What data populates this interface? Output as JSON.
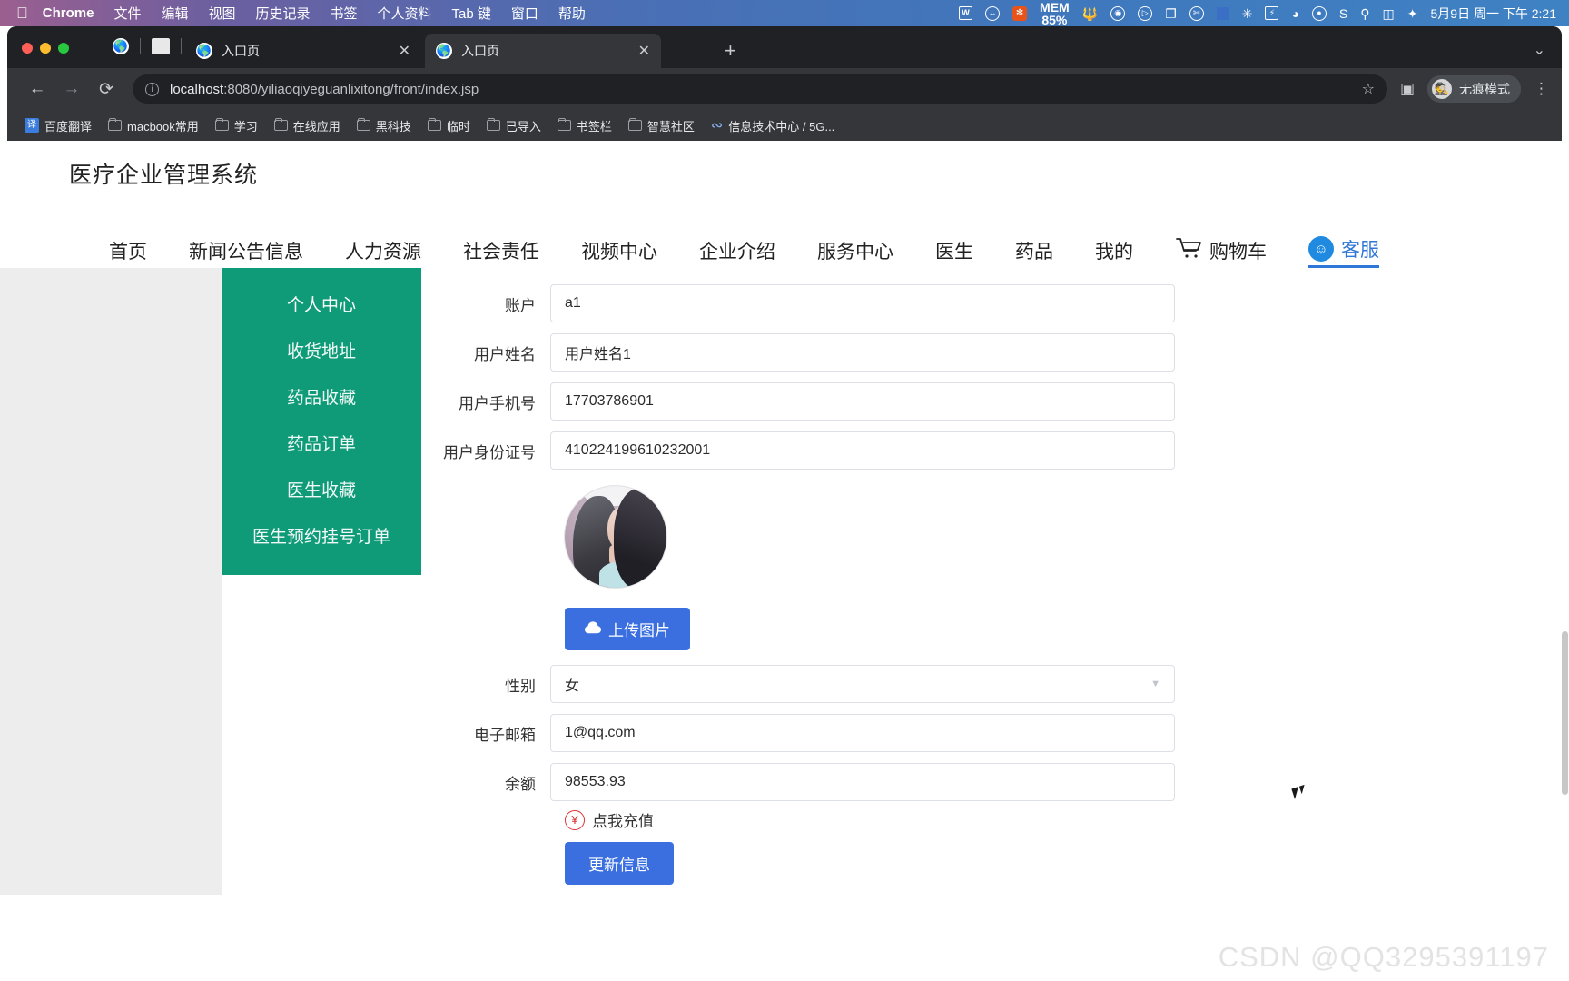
{
  "macbar": {
    "apple_icon": "apple-icon",
    "items": [
      {
        "label": "Chrome",
        "bold": true
      },
      {
        "label": "文件",
        "bold": false
      },
      {
        "label": "编辑",
        "bold": false
      },
      {
        "label": "视图",
        "bold": false
      },
      {
        "label": "历史记录",
        "bold": false
      },
      {
        "label": "书签",
        "bold": false
      },
      {
        "label": "个人资料",
        "bold": false
      },
      {
        "label": "Tab 键",
        "bold": false
      },
      {
        "label": "窗口",
        "bold": false
      },
      {
        "label": "帮助",
        "bold": false
      }
    ],
    "tray": {
      "wechat_work": "W",
      "mem_label": "MEM",
      "mem_value": "85%",
      "bluetooth": "✳",
      "battery": "⚡",
      "clock": "5月9日 周一 下午 2:21"
    }
  },
  "browser": {
    "tabs": [
      {
        "title": "入口页",
        "active": false
      },
      {
        "title": "入口页",
        "active": true
      }
    ],
    "new_tab_label": "+",
    "tab_list_chevron": "⌄",
    "toolbar": {
      "back": "←",
      "forward": "→",
      "reload": "⟳",
      "url_host": "localhost",
      "url_path": ":8080/yiliaoqiyeguanlixitong/front/index.jsp",
      "star": "☆",
      "sidepanel": "▣",
      "menu": "⋮",
      "incognito_label": "无痕模式"
    },
    "bookmarks": [
      {
        "label": "百度翻译",
        "icon": "translate-icon"
      },
      {
        "label": "macbook常用",
        "icon": "folder-icon"
      },
      {
        "label": "学习",
        "icon": "folder-icon"
      },
      {
        "label": "在线应用",
        "icon": "folder-icon"
      },
      {
        "label": "黑科技",
        "icon": "folder-icon"
      },
      {
        "label": "临时",
        "icon": "folder-icon"
      },
      {
        "label": "已导入",
        "icon": "folder-icon"
      },
      {
        "label": "书签栏",
        "icon": "folder-icon"
      },
      {
        "label": "智慧社区",
        "icon": "folder-icon"
      },
      {
        "label": "信息技术中心 / 5G...",
        "icon": "link-icon"
      }
    ]
  },
  "site": {
    "title": "医疗企业管理系统",
    "nav": [
      {
        "label": "首页"
      },
      {
        "label": "新闻公告信息"
      },
      {
        "label": "人力资源"
      },
      {
        "label": "社会责任"
      },
      {
        "label": "视频中心"
      },
      {
        "label": "企业介绍"
      },
      {
        "label": "服务中心"
      },
      {
        "label": "医生"
      },
      {
        "label": "药品"
      },
      {
        "label": "我的"
      }
    ],
    "cart_label": "购物车",
    "service_label": "客服",
    "accent_color": "#2f77d6",
    "sidebar_color": "#0f9b78"
  },
  "sidebar": {
    "items": [
      {
        "label": "个人中心",
        "active": true
      },
      {
        "label": "收货地址",
        "active": false
      },
      {
        "label": "药品收藏",
        "active": false
      },
      {
        "label": "药品订单",
        "active": false
      },
      {
        "label": "医生收藏",
        "active": false
      },
      {
        "label": "医生预约挂号订单",
        "active": false
      }
    ]
  },
  "form": {
    "fields": [
      {
        "label": "账户",
        "value": "a1",
        "type": "text"
      },
      {
        "label": "用户姓名",
        "value": "用户姓名1",
        "type": "text"
      },
      {
        "label": "用户手机号",
        "value": "17703786901",
        "type": "text"
      },
      {
        "label": "用户身份证号",
        "value": "410224199610232001",
        "type": "text"
      }
    ],
    "fields_after_avatar": [
      {
        "label": "性别",
        "value": "女",
        "type": "select"
      },
      {
        "label": "电子邮箱",
        "value": "1@qq.com",
        "type": "text"
      },
      {
        "label": "余额",
        "value": "98553.93",
        "type": "text"
      }
    ],
    "avatar_alt": "用户头像",
    "upload_button": "上传图片",
    "upload_icon": "cloud-upload-icon",
    "recharge_label": "点我充值",
    "recharge_icon": "yen-circle-icon",
    "submit_button": "更新信息",
    "select_caret": "▼"
  },
  "watermark": "CSDN @QQ3295391197"
}
